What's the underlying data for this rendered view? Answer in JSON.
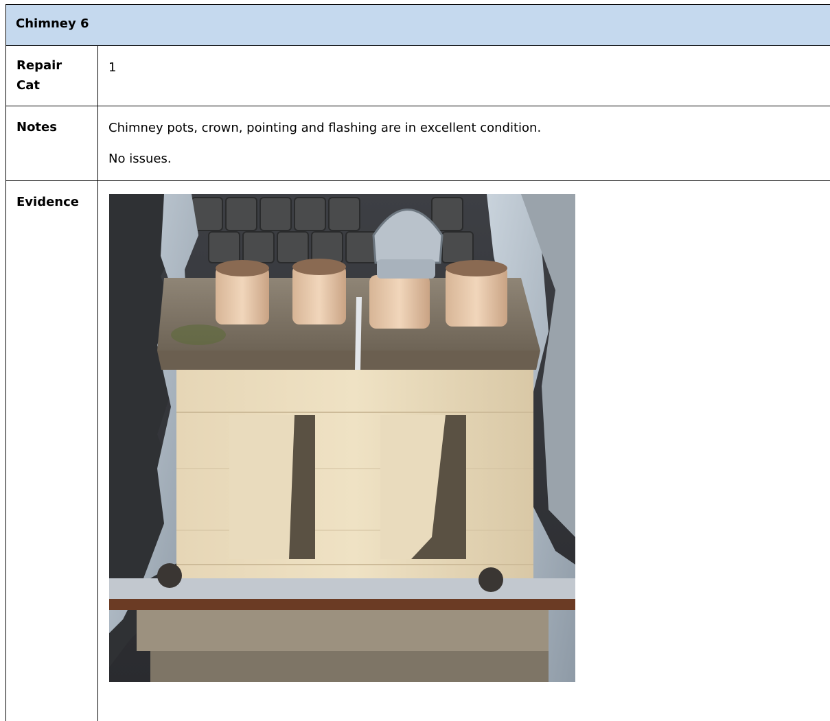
{
  "header": {
    "title": "Chimney 6"
  },
  "rows": {
    "repair_cat": {
      "label_line1": "Repair",
      "label_line2": "Cat",
      "value": "1"
    },
    "notes": {
      "label": "Notes",
      "line1": "Chimney pots, crown, pointing and flashing are in excellent condition.",
      "line2": "No issues."
    },
    "evidence": {
      "label": "Evidence"
    }
  },
  "colors": {
    "header_bg": "#c5d9ee",
    "border": "#000000"
  },
  "photo": {
    "icon": "chimney-photo"
  }
}
